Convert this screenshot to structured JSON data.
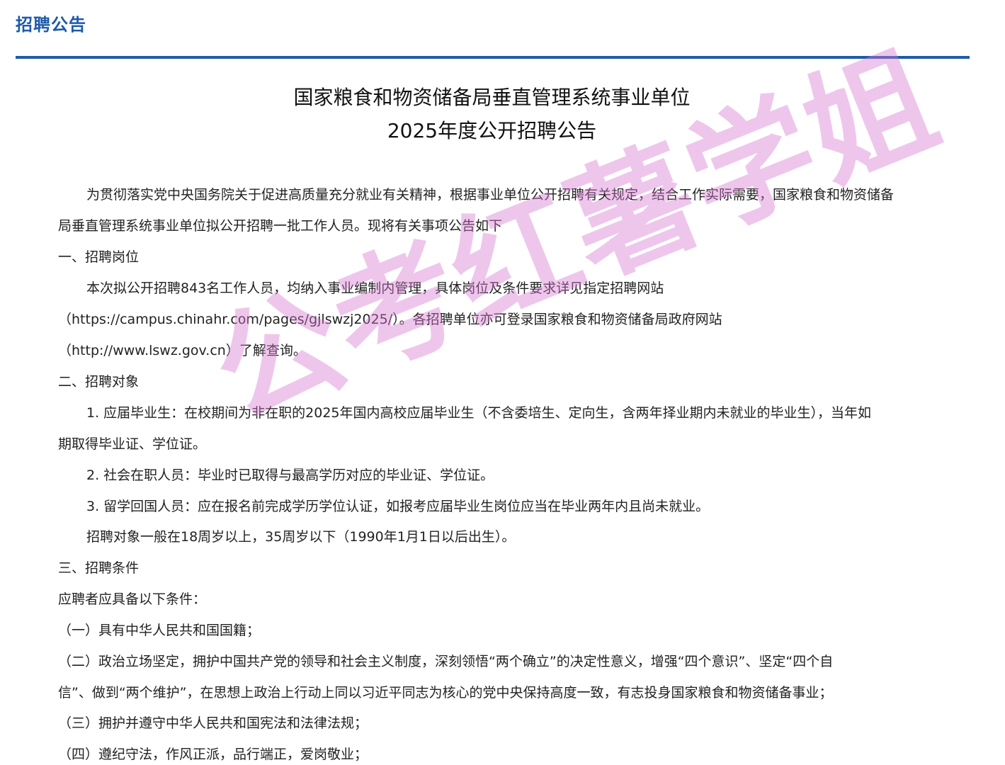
{
  "header": {
    "title": "招聘公告"
  },
  "document": {
    "title_line1": "国家粮食和物资储备局垂直管理系统事业单位",
    "title_line2": "2025年度公开招聘公告",
    "lines": [
      "为贯彻落实党中央国务院关于促进高质量充分就业有关精神，根据事业单位公开招聘有关规定，结合工作实际需要，国家粮食和物资储备",
      "局垂直管理系统事业单位拟公开招聘一批工作人员。现将有关事项公告如下",
      "一、招聘岗位",
      "本次拟公开招聘843名工作人员，均纳入事业编制内管理，具体岗位及条件要求详见指定招聘网站",
      "（https://campus.chinahr.com/pages/gjlswzj2025/）。各招聘单位亦可登录国家粮食和物资储备局政府网站",
      "（http://www.lswz.gov.cn）了解查询。",
      "二、招聘对象",
      "1. 应届毕业生：在校期间为非在职的2025年国内高校应届毕业生（不含委培生、定向生，含两年择业期内未就业的毕业生），当年如",
      "期取得毕业证、学位证。",
      "2. 社会在职人员：毕业时已取得与最高学历对应的毕业证、学位证。",
      "3. 留学回国人员：应在报名前完成学历学位认证，如报考应届毕业生岗位应当在毕业两年内且尚未就业。",
      "招聘对象一般在18周岁以上，35周岁以下（1990年1月1日以后出生）。",
      "三、招聘条件",
      "应聘者应具备以下条件：",
      "（一）具有中华人民共和国国籍；",
      "（二）政治立场坚定，拥护中国共产党的领导和社会主义制度，深刻领悟“两个确立”的决定性意义，增强“四个意识”、坚定“四个自",
      "信”、做到“两个维护”，在思想上政治上行动上同以习近平同志为核心的党中央保持高度一致，有志投身国家粮食和物资储备事业；",
      "（三）拥护并遵守中华人民共和国宪法和法律法规；",
      "（四）遵纪守法，作风正派，品行端正，爱岗敬业；"
    ]
  },
  "watermark": {
    "text": "公考红薯学姐",
    "color": "#d678d2"
  },
  "colors": {
    "accent": "#1e5aa8",
    "text": "#222222"
  }
}
